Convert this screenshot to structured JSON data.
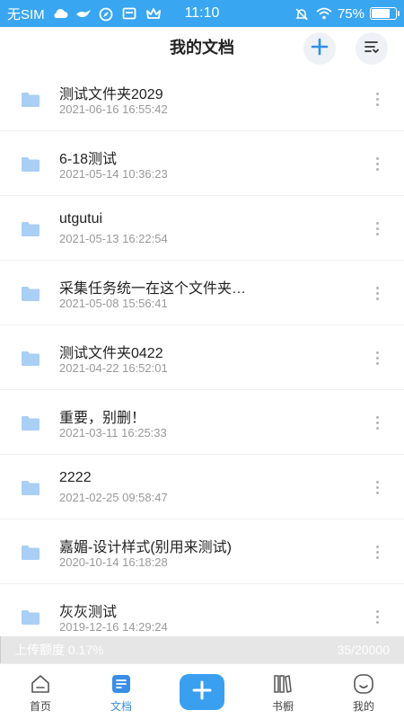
{
  "status_bar": {
    "carrier": "无SIM",
    "time": "11:10",
    "battery": "75%",
    "battery_level": 0.75,
    "icons": [
      "cloud-icon",
      "bird-icon",
      "compass-icon",
      "card-icon",
      "crown-icon",
      "mute-icon",
      "wifi-icon",
      "battery-icon"
    ]
  },
  "header": {
    "title": "我的文档",
    "add_icon": "plus-icon",
    "sort_icon": "sort-icon"
  },
  "files": [
    {
      "name": "测试文件夹2029",
      "date": "2021-06-16 16:55:42"
    },
    {
      "name": "6-18测试",
      "date": "2021-05-14 10:36:23"
    },
    {
      "name": "utgutui",
      "date": "2021-05-13 16:22:54"
    },
    {
      "name": "采集任务统一在这个文件夹…",
      "date": "2021-05-08 15:56:41"
    },
    {
      "name": "测试文件夹0422",
      "date": "2021-04-22 16:52:01"
    },
    {
      "name": "重要，别删！",
      "date": "2021-03-11 16:25:33"
    },
    {
      "name": "2222",
      "date": "2021-02-25 09:58:47"
    },
    {
      "name": "嘉媚-设计样式(别用来测试)",
      "date": "2020-10-14 16:18:28"
    },
    {
      "name": "灰灰测试",
      "date": "2019-12-16 14:29:24"
    }
  ],
  "quota": {
    "label": "上传额度 0.17%",
    "count": "35/20000",
    "fraction": 0.0017
  },
  "tabs": [
    {
      "label": "首页",
      "icon": "home-icon"
    },
    {
      "label": "文档",
      "icon": "document-icon"
    },
    {
      "label": "书橱",
      "icon": "bookshelf-icon"
    },
    {
      "label": "我的",
      "icon": "profile-icon"
    }
  ],
  "colors": {
    "accent": "#3b9ff0",
    "status_bar": "#39a6f2",
    "folder": "#a9cff5",
    "active_tab": "#3a8ee6"
  }
}
